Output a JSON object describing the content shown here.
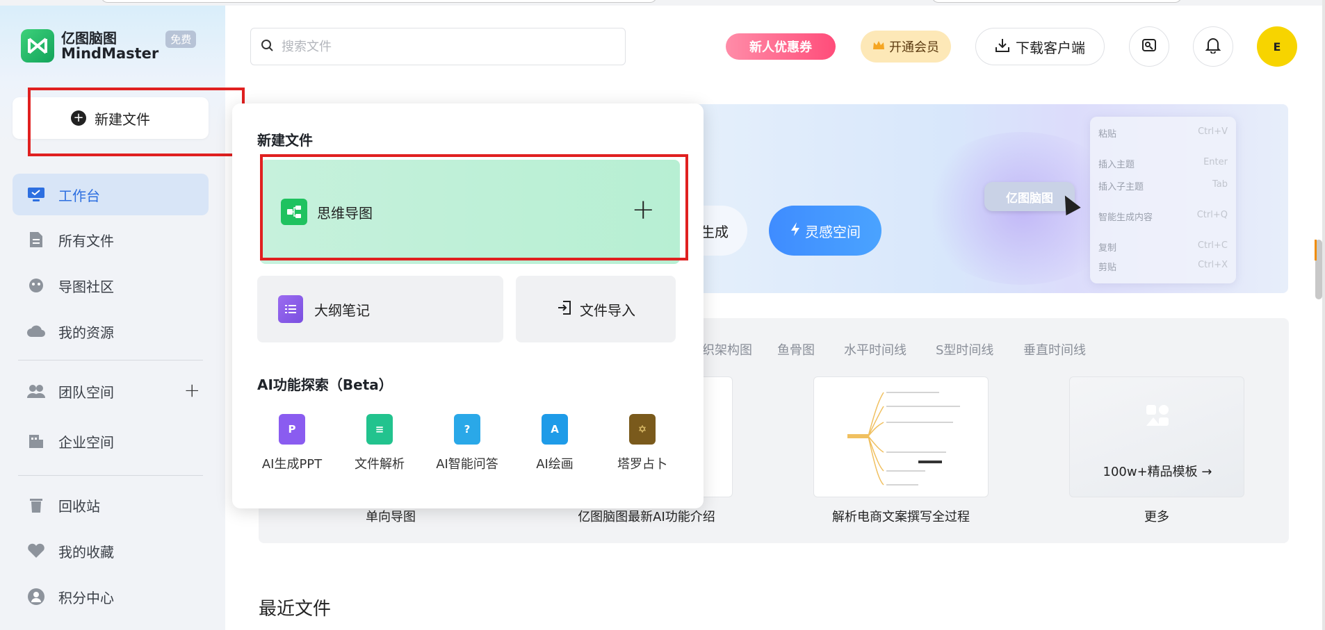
{
  "app": {
    "logo_cn": "亿图脑图",
    "logo_en": "MindMaster",
    "free_badge": "免费"
  },
  "sidebar": {
    "new_file": "新建文件",
    "items": [
      {
        "label": "工作台",
        "icon": "workbench-icon",
        "active": true
      },
      {
        "label": "所有文件",
        "icon": "file-icon"
      },
      {
        "label": "导图社区",
        "icon": "community-icon"
      },
      {
        "label": "我的资源",
        "icon": "cloud-icon"
      },
      {
        "label": "团队空间",
        "icon": "team-icon"
      },
      {
        "label": "企业空间",
        "icon": "enterprise-icon"
      },
      {
        "label": "回收站",
        "icon": "trash-icon"
      },
      {
        "label": "我的收藏",
        "icon": "heart-icon"
      },
      {
        "label": "积分中心",
        "icon": "user-icon"
      }
    ]
  },
  "header": {
    "search_placeholder": "搜索文件",
    "promo": "新人优惠券",
    "vip": "开通会员",
    "download": "下载客户端",
    "avatar": "E"
  },
  "banner": {
    "pill_left": "生成",
    "pill_inspire": "灵感空间",
    "node_label": "亿图脑图",
    "menu": [
      {
        "label": "粘贴",
        "shortcut": "Ctrl+V"
      },
      {
        "label": "插入主题",
        "shortcut": "Enter"
      },
      {
        "label": "插入子主题",
        "shortcut": "Tab"
      },
      {
        "label": "智能生成内容",
        "shortcut": "Ctrl+Q"
      },
      {
        "label": "复制",
        "shortcut": "Ctrl+C"
      },
      {
        "label": "剪贴",
        "shortcut": "Ctrl+X"
      }
    ]
  },
  "templates": {
    "tabs": [
      "织架构图",
      "鱼骨图",
      "水平时间线",
      "S型时间线",
      "垂直时间线"
    ],
    "cards": [
      {
        "caption": "单向导图"
      },
      {
        "caption": "亿图脑图最新AI功能介绍"
      },
      {
        "caption": "解析电商文案撰写全过程"
      },
      {
        "caption": "更多",
        "overlay": "100w+精品模板 →"
      }
    ]
  },
  "recent": "最近文件",
  "dropdown": {
    "title": "新建文件",
    "mindmap": "思维导图",
    "outline": "大纲笔记",
    "import": "文件导入",
    "ai_title": "AI功能探索（Beta）",
    "ai_items": [
      {
        "label": "AI生成PPT",
        "icon": "ppt-icon",
        "color": "#8a5cf0"
      },
      {
        "label": "文件解析",
        "icon": "doc-parse-icon",
        "color": "#22c38e"
      },
      {
        "label": "AI智能问答",
        "icon": "qa-icon",
        "color": "#2aa8e8"
      },
      {
        "label": "AI绘画",
        "icon": "paint-icon",
        "color": "#1e9be8"
      },
      {
        "label": "塔罗占卜",
        "icon": "tarot-icon",
        "color": "#7a5a1c"
      }
    ]
  },
  "colors": {
    "accent": "#2d6fe0",
    "highlight": "#e02020",
    "mindmap_green": "#1fc25f"
  }
}
